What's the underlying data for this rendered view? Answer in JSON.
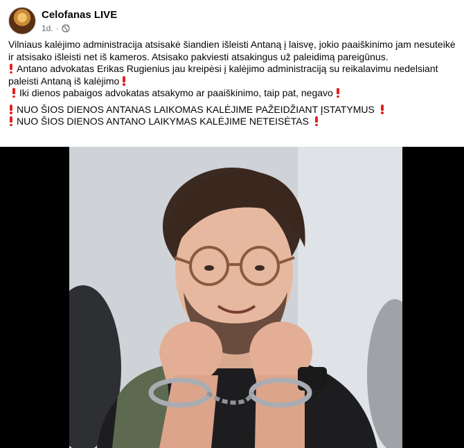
{
  "post": {
    "page_name": "Celofanas LIVE",
    "time": "1d.",
    "separator": "·",
    "privacy_icon": "globe-icon",
    "paragraph1": "Vilniaus kalėjimo administracija atsisakė šiandien išleisti Antaną į laisvę, jokio paaiškinimo jam nesuteikė ir atsisako išleisti net iš kameros. Atsisako pakviesti atsakingus už paleidimą pareigūnus.",
    "paragraph2": "Antano advokatas Erikas Rugienius jau kreipėsi į kalėjimo administraciją su reikalavimu nedelsiant paleisti Antaną iš kalėjimo",
    "paragraph3": "Iki dienos pabaigos advokatas atsakymo ar paaiškinimo, taip pat, negavo",
    "paragraph4": "NUO ŠIOS DIENOS ANTANAS LAIKOMAS KALĖJIME PAŽEIDŽIANT ĮSTATYMUS",
    "paragraph5": "NUO ŠIOS DIENOS ANTANO LAIKYMAS KALĖJIME NETEISĖTAS",
    "emphasis_icon": "red-exclamation-icon",
    "emphasis_color": "#e0211f"
  },
  "photo": {
    "background": "#000000"
  }
}
